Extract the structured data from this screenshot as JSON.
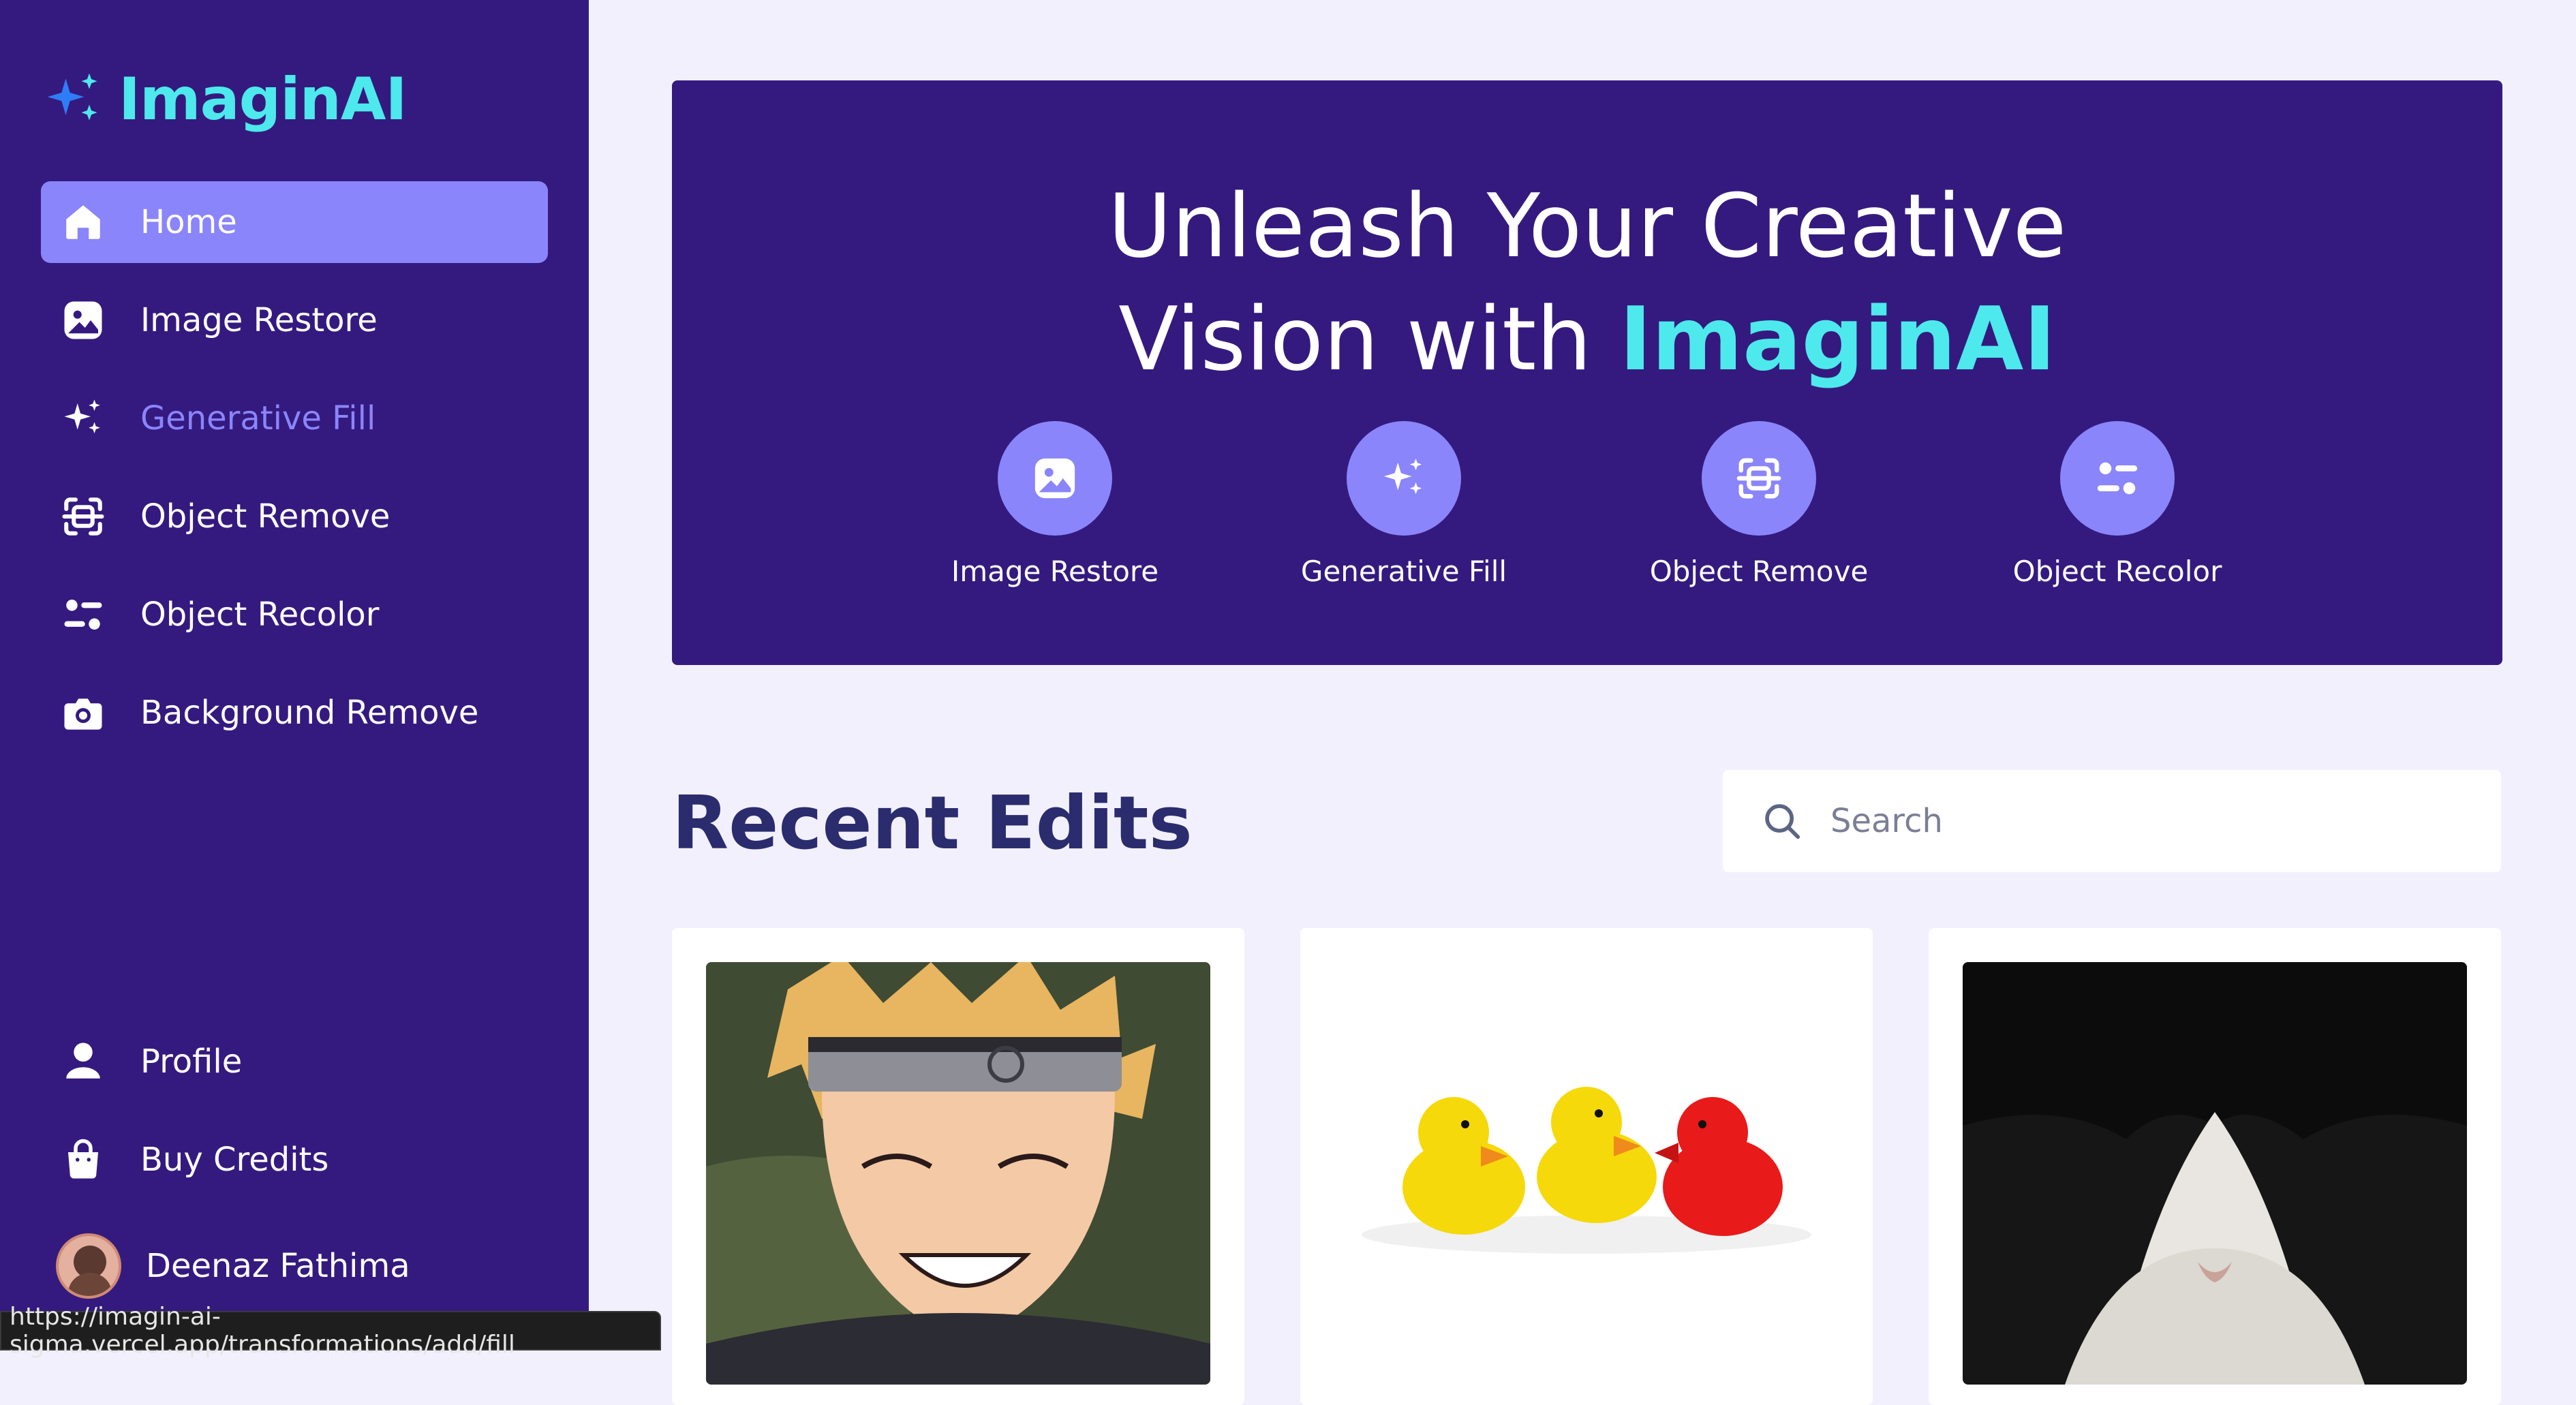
{
  "app": {
    "logo_text": "ImaginAI",
    "accent": "#4DE9EC",
    "primary": "#341A7F",
    "highlight": "#8A85FA"
  },
  "sidebar": {
    "items": [
      {
        "label": "Home",
        "icon": "home-icon",
        "active": true
      },
      {
        "label": "Image Restore",
        "icon": "image-icon"
      },
      {
        "label": "Generative Fill",
        "icon": "sparkles-icon",
        "hovered": true
      },
      {
        "label": "Object Remove",
        "icon": "scan-icon"
      },
      {
        "label": "Object Recolor",
        "icon": "filter-icon"
      },
      {
        "label": "Background Remove",
        "icon": "camera-icon"
      }
    ],
    "bottom_items": [
      {
        "label": "Profile",
        "icon": "user-icon"
      },
      {
        "label": "Buy Credits",
        "icon": "bag-icon"
      }
    ],
    "user": {
      "name": "Deenaz Fathima"
    }
  },
  "hero": {
    "title_line1": "Unleash Your Creative",
    "title_line2_prefix": "Vision with ",
    "title_brand": "ImaginAI",
    "tools": [
      {
        "label": "Image Restore",
        "icon": "image-icon"
      },
      {
        "label": "Generative Fill",
        "icon": "sparkles-icon"
      },
      {
        "label": "Object Remove",
        "icon": "scan-icon"
      },
      {
        "label": "Object Recolor",
        "icon": "filter-icon"
      }
    ]
  },
  "recent": {
    "title": "Recent Edits",
    "search_placeholder": "Search",
    "cards": [
      {
        "thumb": "anime-character-image"
      },
      {
        "thumb": "rubber-ducks-image"
      },
      {
        "thumb": "cat-closeup-image"
      }
    ]
  },
  "status_bar": {
    "url": "https://imagin-ai-sigma.vercel.app/transformations/add/fill"
  }
}
